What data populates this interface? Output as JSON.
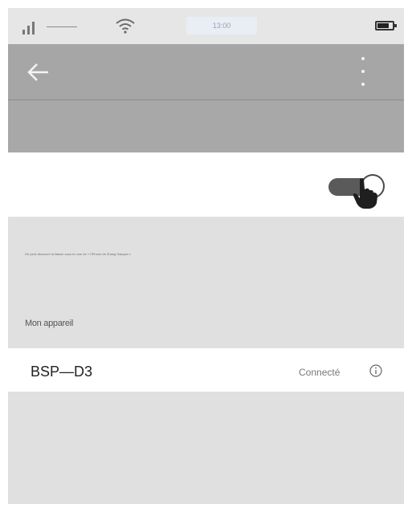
{
  "status_bar": {
    "time": "13:00"
  },
  "app_bar": {
    "back_icon": "arrow-left-icon",
    "menu_icon": "more-vert-icon"
  },
  "bluetooth": {
    "enabled": true,
    "visibility_text": "On peut découvrir la liaison sous le nom de « l'iPhone de Zhang Xiaoyan »"
  },
  "devices_section": {
    "label": "Mon appareil"
  },
  "device": {
    "name": "BSP—D3",
    "status": "Connecté",
    "info_icon": "info-circle-icon"
  },
  "colors": {
    "app_bar": "#a6a6a6",
    "panel": "#e0e0e0",
    "toggle": "#5a5a5a"
  }
}
